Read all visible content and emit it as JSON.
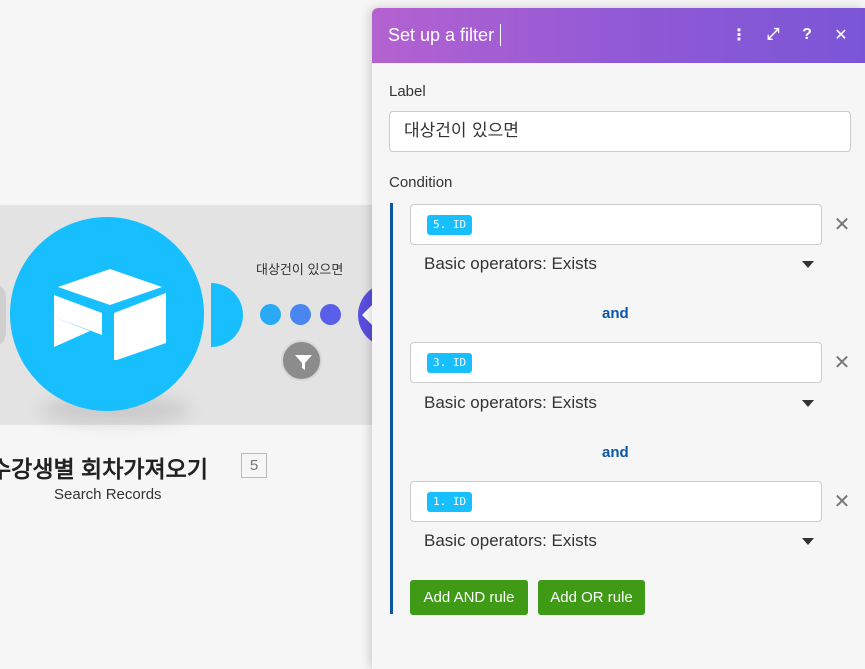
{
  "canvas": {
    "filter_label": "대상건이 있으면",
    "module_title": "수강생별 회차가져오기",
    "module_badge": "5",
    "module_subtitle": "Search Records",
    "module_icon": "airtable-icon",
    "filter_icon": "funnel-icon",
    "colors": {
      "module": "#18bfff",
      "dot1": "#2aa9f5",
      "dot2": "#4a86ee",
      "dot3": "#5860ea",
      "next": "#5a4fe0"
    }
  },
  "panel": {
    "title": "Set up a filter",
    "header_icons": [
      "more-vertical-icon",
      "expand-icon",
      "help-icon",
      "close-icon"
    ],
    "header_glyphs": {
      "more": "⋮",
      "expand": "⤢",
      "help": "?",
      "close": "✕"
    },
    "label_field": {
      "label": "Label",
      "value": "대상건이 있으면"
    },
    "condition_label": "Condition",
    "rules": [
      {
        "pill": "5. ID",
        "operator": "Basic operators: Exists"
      },
      {
        "pill": "3. ID",
        "operator": "Basic operators: Exists"
      },
      {
        "pill": "1. ID",
        "operator": "Basic operators: Exists"
      }
    ],
    "connectors": [
      "and",
      "and"
    ],
    "close_glyph": "✕",
    "add_and_label": "Add AND rule",
    "add_or_label": "Add OR rule",
    "colors": {
      "header_start": "#b462d0",
      "header_end": "#7a56d6",
      "accent": "#0a57a6",
      "button": "#3f9b15",
      "pill": "#18bfff"
    }
  }
}
